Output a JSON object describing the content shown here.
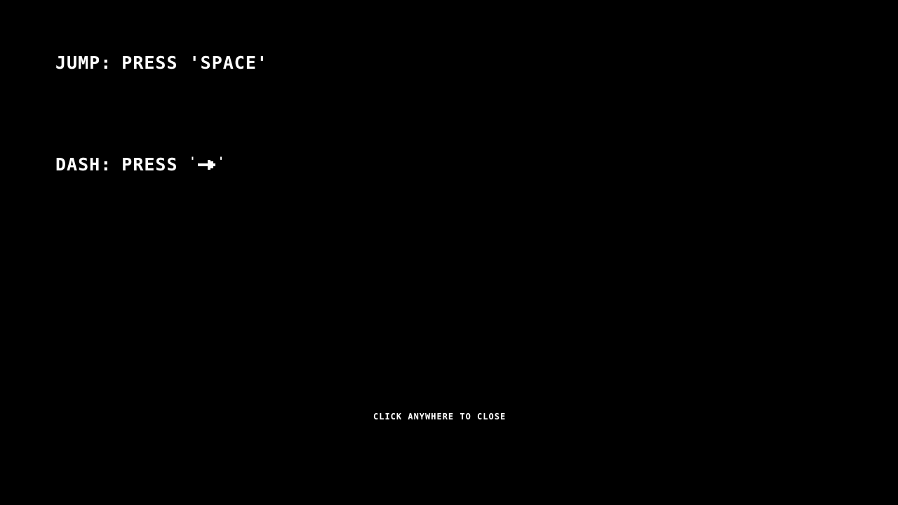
{
  "controls": {
    "jump": {
      "label": "JUMP:",
      "press": "PRESS",
      "key": "'SPACE'"
    },
    "dash": {
      "label": "DASH:",
      "press": "PRESS",
      "key_open": "'",
      "key_icon": "right-arrow-icon",
      "key_close": "'"
    }
  },
  "close_hint": "CLICK ANYWHERE TO CLOSE",
  "colors": {
    "background": "#000000",
    "text": "#ffffff"
  }
}
